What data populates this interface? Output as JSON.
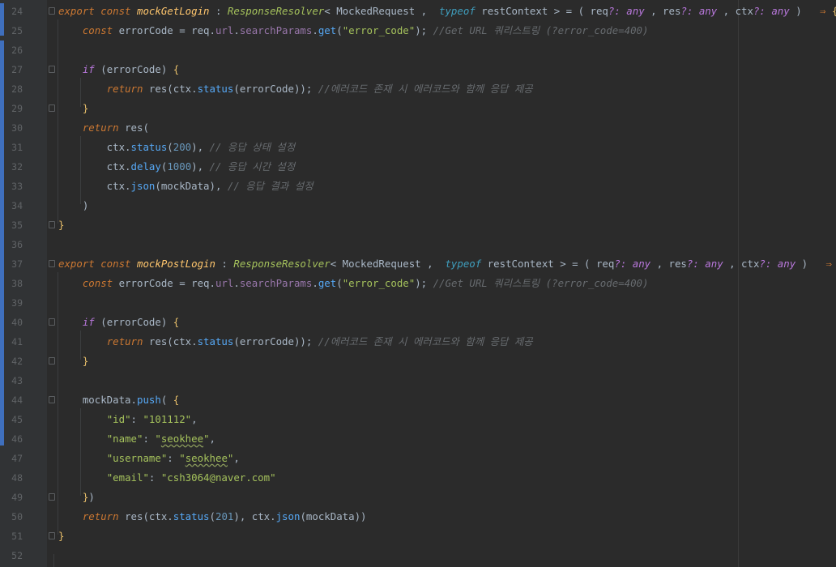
{
  "editor": {
    "lines": [
      {
        "n": "24",
        "tokens": [
          [
            "kw",
            "export "
          ],
          [
            "kw",
            "const "
          ],
          [
            "fn",
            "mockGetLogin"
          ],
          [
            "punct",
            " : "
          ],
          [
            "ty-i",
            "ResponseResolver"
          ],
          [
            "punct",
            "< "
          ],
          [
            "ty",
            "MockedRequest"
          ],
          [
            "punct",
            " ,  "
          ],
          [
            "tyof",
            "typeof "
          ],
          [
            "ty",
            "restContext"
          ],
          [
            "punct",
            " > = ( req"
          ],
          [
            "any",
            "?: any"
          ],
          [
            "punct",
            " , res"
          ],
          [
            "any",
            "?: any"
          ],
          [
            "punct",
            " , ctx"
          ],
          [
            "any",
            "?: any"
          ],
          [
            "punct",
            " )   "
          ],
          [
            "kw2",
            "⇒ "
          ],
          [
            "brace",
            "{"
          ]
        ]
      },
      {
        "n": "25",
        "tokens": [
          [
            "punct",
            "    "
          ],
          [
            "kw",
            "const "
          ],
          [
            "punct",
            "errorCode = req."
          ],
          [
            "prop",
            "url"
          ],
          [
            "punct",
            "."
          ],
          [
            "prop",
            "searchParams"
          ],
          [
            "punct",
            "."
          ],
          [
            "mt",
            "get"
          ],
          [
            "punct",
            "("
          ],
          [
            "str",
            "\"error_code\""
          ],
          [
            "punct",
            ");"
          ],
          [
            "cm",
            " //Get URL 쿼리스트링 (?error_code=400)"
          ]
        ]
      },
      {
        "n": "26",
        "tokens": []
      },
      {
        "n": "27",
        "tokens": [
          [
            "punct",
            "    "
          ],
          [
            "ctl",
            "if "
          ],
          [
            "punct",
            "(errorCode) "
          ],
          [
            "brace",
            "{"
          ]
        ]
      },
      {
        "n": "28",
        "tokens": [
          [
            "punct",
            "        "
          ],
          [
            "kw",
            "return "
          ],
          [
            "punct",
            "res(ctx."
          ],
          [
            "mt",
            "status"
          ],
          [
            "punct",
            "(errorCode));"
          ],
          [
            "cm",
            " //에러코드 존재 시 에러코드와 함께 응답 제공"
          ]
        ]
      },
      {
        "n": "29",
        "tokens": [
          [
            "punct",
            "    "
          ],
          [
            "brace",
            "}"
          ]
        ]
      },
      {
        "n": "30",
        "tokens": [
          [
            "punct",
            "    "
          ],
          [
            "kw",
            "return "
          ],
          [
            "punct",
            "res("
          ]
        ]
      },
      {
        "n": "31",
        "tokens": [
          [
            "punct",
            "        ctx."
          ],
          [
            "mt",
            "status"
          ],
          [
            "punct",
            "("
          ],
          [
            "num",
            "200"
          ],
          [
            "punct",
            "),"
          ],
          [
            "cm",
            " // 응답 상태 설정"
          ]
        ]
      },
      {
        "n": "32",
        "tokens": [
          [
            "punct",
            "        ctx."
          ],
          [
            "mt",
            "delay"
          ],
          [
            "punct",
            "("
          ],
          [
            "num",
            "1000"
          ],
          [
            "punct",
            "),"
          ],
          [
            "cm",
            " // 응답 시간 설정"
          ]
        ]
      },
      {
        "n": "33",
        "tokens": [
          [
            "punct",
            "        ctx."
          ],
          [
            "mt",
            "json"
          ],
          [
            "punct",
            "(mockData),"
          ],
          [
            "cm",
            " // 응답 결과 설정"
          ]
        ]
      },
      {
        "n": "34",
        "tokens": [
          [
            "punct",
            "    )"
          ]
        ]
      },
      {
        "n": "35",
        "tokens": [
          [
            "brace",
            "}"
          ]
        ]
      },
      {
        "n": "36",
        "tokens": []
      },
      {
        "n": "37",
        "tokens": [
          [
            "kw",
            "export "
          ],
          [
            "kw",
            "const "
          ],
          [
            "fn",
            "mockPostLogin"
          ],
          [
            "punct",
            " : "
          ],
          [
            "ty-i",
            "ResponseResolver"
          ],
          [
            "punct",
            "< "
          ],
          [
            "ty",
            "MockedRequest"
          ],
          [
            "punct",
            " ,  "
          ],
          [
            "tyof",
            "typeof "
          ],
          [
            "ty",
            "restContext"
          ],
          [
            "punct",
            " > = ( req"
          ],
          [
            "any",
            "?: any"
          ],
          [
            "punct",
            " , res"
          ],
          [
            "any",
            "?: any"
          ],
          [
            "punct",
            " , ctx"
          ],
          [
            "any",
            "?: any"
          ],
          [
            "punct",
            " )   "
          ],
          [
            "kw2",
            "⇒ "
          ],
          [
            "brace",
            "{"
          ]
        ]
      },
      {
        "n": "38",
        "tokens": [
          [
            "punct",
            "    "
          ],
          [
            "kw",
            "const "
          ],
          [
            "punct",
            "errorCode = req."
          ],
          [
            "prop",
            "url"
          ],
          [
            "punct",
            "."
          ],
          [
            "prop",
            "searchParams"
          ],
          [
            "punct",
            "."
          ],
          [
            "mt",
            "get"
          ],
          [
            "punct",
            "("
          ],
          [
            "str",
            "\"error_code\""
          ],
          [
            "punct",
            ");"
          ],
          [
            "cm",
            " //Get URL 쿼리스트링 (?error_code=400)"
          ]
        ]
      },
      {
        "n": "39",
        "tokens": []
      },
      {
        "n": "40",
        "tokens": [
          [
            "punct",
            "    "
          ],
          [
            "ctl",
            "if "
          ],
          [
            "punct",
            "(errorCode) "
          ],
          [
            "brace",
            "{"
          ]
        ]
      },
      {
        "n": "41",
        "tokens": [
          [
            "punct",
            "        "
          ],
          [
            "kw",
            "return "
          ],
          [
            "punct",
            "res(ctx."
          ],
          [
            "mt",
            "status"
          ],
          [
            "punct",
            "(errorCode));"
          ],
          [
            "cm",
            " //에러코드 존재 시 에러코드와 함께 응답 제공"
          ]
        ]
      },
      {
        "n": "42",
        "tokens": [
          [
            "punct",
            "    "
          ],
          [
            "brace",
            "}"
          ]
        ]
      },
      {
        "n": "43",
        "tokens": []
      },
      {
        "n": "44",
        "tokens": [
          [
            "punct",
            "    mockData."
          ],
          [
            "mt",
            "push"
          ],
          [
            "punct",
            "( "
          ],
          [
            "brace",
            "{"
          ]
        ]
      },
      {
        "n": "45",
        "tokens": [
          [
            "punct",
            "        "
          ],
          [
            "str",
            "\"id\""
          ],
          [
            "punct",
            ": "
          ],
          [
            "str",
            "\"101112\""
          ],
          [
            "punct",
            ","
          ]
        ]
      },
      {
        "n": "46",
        "tokens": [
          [
            "punct",
            "        "
          ],
          [
            "str",
            "\"name\""
          ],
          [
            "punct",
            ": "
          ],
          [
            "str",
            "\""
          ],
          [
            "str typo",
            "seokhee"
          ],
          [
            "str",
            "\""
          ],
          [
            "punct",
            ","
          ]
        ]
      },
      {
        "n": "47",
        "tokens": [
          [
            "punct",
            "        "
          ],
          [
            "str",
            "\"username\""
          ],
          [
            "punct",
            ": "
          ],
          [
            "str",
            "\""
          ],
          [
            "str typo",
            "seokhee"
          ],
          [
            "str",
            "\""
          ],
          [
            "punct",
            ","
          ]
        ]
      },
      {
        "n": "48",
        "tokens": [
          [
            "punct",
            "        "
          ],
          [
            "str",
            "\"email\""
          ],
          [
            "punct",
            ": "
          ],
          [
            "str",
            "\"csh3064@naver.com\""
          ]
        ]
      },
      {
        "n": "49",
        "tokens": [
          [
            "punct",
            "    "
          ],
          [
            "brace",
            "}"
          ],
          [
            "punct",
            ")"
          ]
        ]
      },
      {
        "n": "50",
        "tokens": [
          [
            "punct",
            "    "
          ],
          [
            "kw",
            "return "
          ],
          [
            "punct",
            "res(ctx."
          ],
          [
            "mt",
            "status"
          ],
          [
            "punct",
            "("
          ],
          [
            "num",
            "201"
          ],
          [
            "punct",
            "), ctx."
          ],
          [
            "mt",
            "json"
          ],
          [
            "punct",
            "(mockData))"
          ]
        ]
      },
      {
        "n": "51",
        "tokens": [
          [
            "brace",
            "}"
          ]
        ]
      },
      {
        "n": "52",
        "tokens": []
      }
    ]
  }
}
